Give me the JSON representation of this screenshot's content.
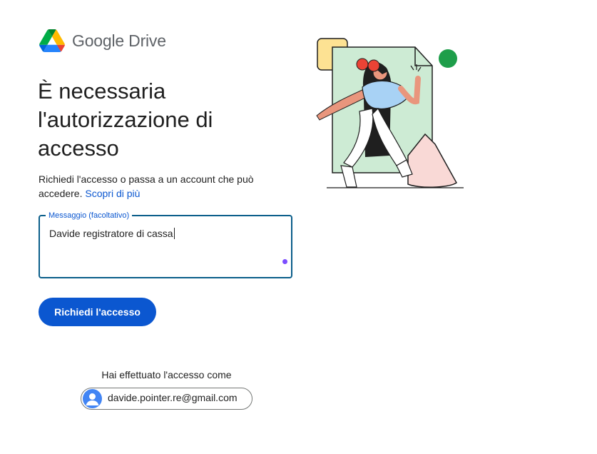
{
  "header": {
    "logo_icon": "google-drive-logo",
    "brand_name": "Google Drive"
  },
  "main": {
    "title": "È necessaria l'autorizzazione di accesso",
    "description": "Richiedi l'accesso o passa a un account che può accedere.",
    "learn_more_link": "Scopri di più",
    "message_field": {
      "label": "Messaggio (facoltativo)",
      "value": "Davide registratore di cassa"
    },
    "request_button_label": "Richiedi l'accesso"
  },
  "account": {
    "signed_in_text": "Hai effettuato l'accesso come",
    "email": "davide.pointer.re@gmail.com",
    "avatar_icon": "account-avatar-icon"
  },
  "illustration": {
    "description_icon": "access-request-illustration"
  },
  "colors": {
    "accent": "#0b57d0",
    "field_border": "#0b5e8a",
    "text": "#1f1f1f",
    "brand_text": "#5f6368"
  }
}
